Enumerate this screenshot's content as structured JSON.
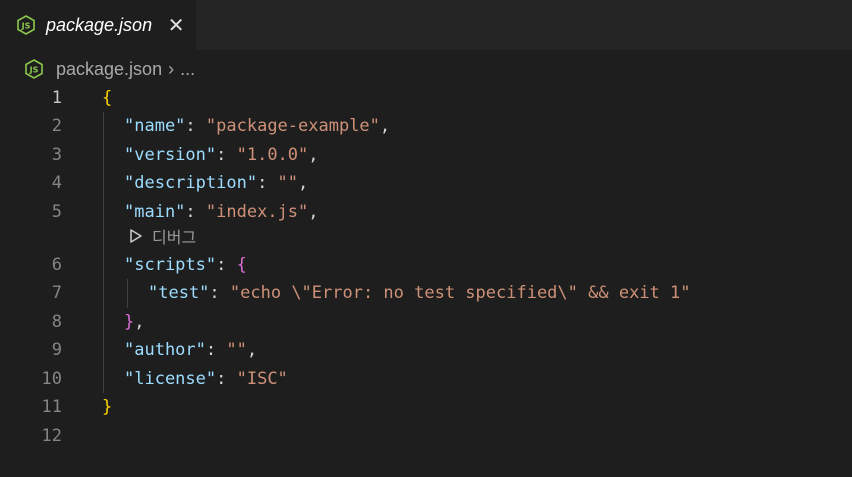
{
  "tab": {
    "title": "package.json",
    "close_glyph": "✕",
    "icon": "nodejs-icon"
  },
  "breadcrumb": {
    "file": "package.json",
    "separator": "›",
    "ellipsis": "..."
  },
  "codelens": {
    "label": "디버그",
    "icon": "play-icon"
  },
  "line_numbers": [
    "1",
    "2",
    "3",
    "4",
    "5",
    "6",
    "7",
    "8",
    "9",
    "10",
    "11",
    "12"
  ],
  "code": {
    "l1": {
      "brace": "{"
    },
    "l2": {
      "key": "\"name\"",
      "colon": ": ",
      "value": "\"package-example\"",
      "comma": ","
    },
    "l3": {
      "key": "\"version\"",
      "colon": ": ",
      "value": "\"1.0.0\"",
      "comma": ","
    },
    "l4": {
      "key": "\"description\"",
      "colon": ": ",
      "value": "\"\"",
      "comma": ","
    },
    "l5": {
      "key": "\"main\"",
      "colon": ": ",
      "value": "\"index.js\"",
      "comma": ","
    },
    "l6": {
      "key": "\"scripts\"",
      "colon": ": ",
      "brace": "{"
    },
    "l7": {
      "key": "\"test\"",
      "colon": ": ",
      "value": "\"echo \\\"Error: no test specified\\\" && exit 1\""
    },
    "l8": {
      "brace": "}",
      "comma": ","
    },
    "l9": {
      "key": "\"author\"",
      "colon": ": ",
      "value": "\"\"",
      "comma": ","
    },
    "l10": {
      "key": "\"license\"",
      "colon": ": ",
      "value": "\"ISC\""
    },
    "l11": {
      "brace": "}"
    }
  },
  "colors": {
    "editor_bg": "#1e1e1e",
    "key": "#9cdcfe",
    "string": "#ce9178",
    "bracket_level1": "#ffd700",
    "bracket_level2": "#da70d6",
    "nodejs_green": "#8cc84b"
  }
}
